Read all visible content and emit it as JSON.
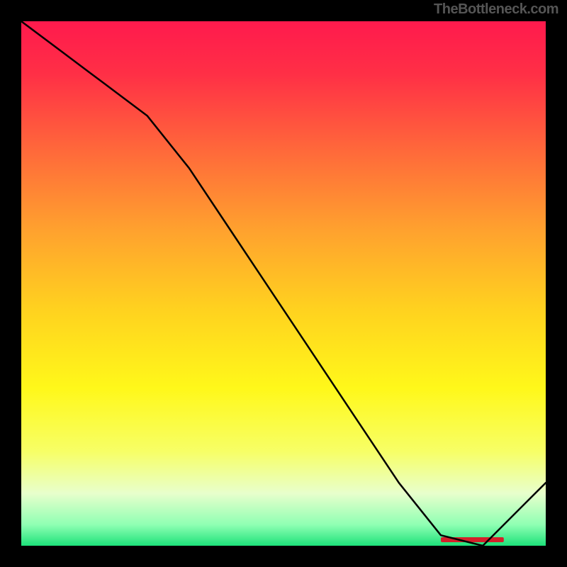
{
  "watermark": "TheBottleneck.com",
  "chart_data": {
    "type": "line",
    "title": "",
    "xlabel": "",
    "ylabel": "",
    "xlim": [
      0,
      100
    ],
    "ylim": [
      0,
      100
    ],
    "x": [
      0,
      8,
      16,
      24,
      32,
      40,
      48,
      56,
      64,
      72,
      80,
      88,
      96,
      100
    ],
    "values": [
      100,
      94,
      88,
      82,
      72,
      60,
      48,
      36,
      24,
      12,
      2,
      0,
      8,
      12
    ],
    "optimal_x_range": [
      80,
      92
    ],
    "annotation_label": "",
    "gradient_stops": [
      {
        "offset": 0.0,
        "color": "#ff1a4d"
      },
      {
        "offset": 0.1,
        "color": "#ff2f46"
      },
      {
        "offset": 0.25,
        "color": "#ff6a3a"
      },
      {
        "offset": 0.4,
        "color": "#ffa22e"
      },
      {
        "offset": 0.55,
        "color": "#ffd21f"
      },
      {
        "offset": 0.7,
        "color": "#fff81a"
      },
      {
        "offset": 0.82,
        "color": "#f7ff66"
      },
      {
        "offset": 0.9,
        "color": "#e8ffcc"
      },
      {
        "offset": 0.96,
        "color": "#8fffb3"
      },
      {
        "offset": 1.0,
        "color": "#1de27a"
      }
    ]
  }
}
